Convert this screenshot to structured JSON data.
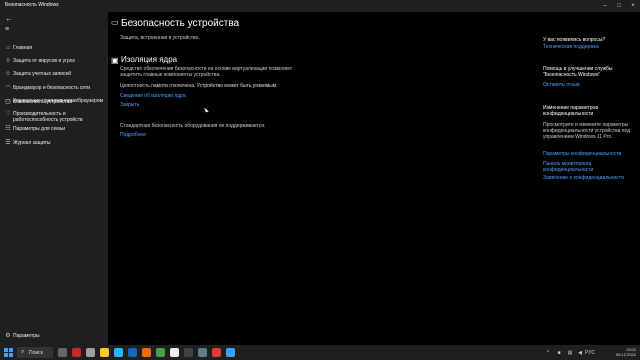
{
  "window": {
    "title": "Безопасность Windows"
  },
  "sidebar": {
    "items": [
      {
        "label": "Главная",
        "icon": "home-icon"
      },
      {
        "label": "Защита от вирусов и угроз",
        "icon": "shield-icon"
      },
      {
        "label": "Защита учетных записей",
        "icon": "person-icon"
      },
      {
        "label": "Брандмауэр и безопасность сети",
        "icon": "wifi-icon"
      },
      {
        "label": "Управление приложениями/браузером",
        "icon": "app-browser-icon"
      },
      {
        "label": "Безопасность устройства",
        "icon": "device-icon"
      },
      {
        "label": "Производительность и работоспособность устройств",
        "icon": "heart-icon"
      },
      {
        "label": "Параметры для семьи",
        "icon": "family-icon"
      },
      {
        "label": "Журнал защиты",
        "icon": "history-icon"
      }
    ],
    "settings_label": "Параметры"
  },
  "main": {
    "title": "Безопасность устройства",
    "subtitle": "Защита, встроенная в устройство.",
    "core_isolation": {
      "title": "Изоляция ядра",
      "description": "Средство обеспечения безопасности на основе виртуализации позволяет защитить главные компоненты устройства.",
      "status": "Целостность памяти отключена. Устройство может быть уязвимым.",
      "details_link": "Сведения об изоляции ядра",
      "dismiss_link": "Закрыть"
    },
    "hardware": {
      "text": "Стандартная безопасность оборудования не поддерживается.",
      "more_link": "Подробнее"
    }
  },
  "right": {
    "q_heading": "У вас появились вопросы?",
    "q_link": "Техническая поддержка",
    "feedback_heading": "Помощь в улучшении службы \"Безопасность Windows\"",
    "feedback_link": "Оставить отзыв",
    "privacy_heading": "Изменение параметров конфиденциальности",
    "privacy_text": "Просмотрите и измените параметры конфиденциальности устройства под управлением Windows 11 Pro.",
    "privacy_links": [
      "Параметры конфиденциальности",
      "Панель мониторинга конфиденциальности",
      "Заявление о конфиденциальности"
    ]
  },
  "taskbar": {
    "search_label": "Поиск",
    "apps": [
      "file-explorer-icon",
      "browser-icon",
      "app-icon",
      "app-icon",
      "app-icon",
      "app-icon",
      "app-icon",
      "app-icon",
      "app-icon",
      "app-icon",
      "app-icon",
      "app-icon",
      "app-icon",
      "security-icon"
    ],
    "tray": {
      "lang": "РУС",
      "time": "13:02",
      "date": "05.12.2022"
    }
  },
  "colors": {
    "accent": "#4aa3ff",
    "background": "#000000",
    "panel": "#1f1f1f"
  }
}
